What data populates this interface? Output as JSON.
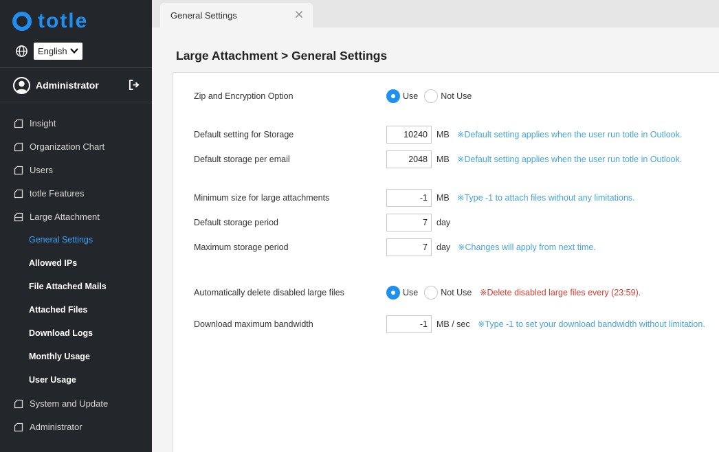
{
  "app": {
    "logo_text": "totle",
    "language": "English",
    "user": "Administrator"
  },
  "nav": {
    "items_top": [
      {
        "label": "Insight"
      },
      {
        "label": "Organization Chart"
      },
      {
        "label": "Users"
      },
      {
        "label": "totle Features"
      },
      {
        "label": "Large Attachment"
      }
    ],
    "sub_items": [
      {
        "label": "General Settings"
      },
      {
        "label": "Allowed IPs"
      },
      {
        "label": "File Attached Mails"
      },
      {
        "label": "Attached Files"
      },
      {
        "label": "Download Logs"
      },
      {
        "label": "Monthly Usage"
      },
      {
        "label": "User Usage"
      }
    ],
    "items_bottom": [
      {
        "label": "System and Update"
      },
      {
        "label": "Administrator"
      }
    ]
  },
  "tab": {
    "label": "General Settings"
  },
  "page": {
    "title": "Large Attachment > General Settings"
  },
  "settings": {
    "zip": {
      "label": "Zip and Encryption Option",
      "use": "Use",
      "not_use": "Not Use"
    },
    "storage": {
      "label": "Default setting for Storage",
      "value": "10240",
      "unit": "MB",
      "note": "※Default setting applies when the user run totle in Outlook."
    },
    "per_email": {
      "label": "Default storage per email",
      "value": "2048",
      "unit": "MB",
      "note": "※Default setting applies when the user run totle in Outlook."
    },
    "min_size": {
      "label": "Minimum size for large attachments",
      "value": "-1",
      "unit": "MB",
      "note": "※Type -1 to attach files without any limitations."
    },
    "period": {
      "label": "Default storage period",
      "value": "7",
      "unit": "day"
    },
    "max_period": {
      "label": "Maximum storage period",
      "value": "7",
      "unit": "day",
      "note": "※Changes will apply from next time."
    },
    "auto_delete": {
      "label": "Automatically delete disabled large files",
      "use": "Use",
      "not_use": "Not Use",
      "note": "※Delete disabled large files every (23:59)."
    },
    "bandwidth": {
      "label": "Download maximum bandwidth",
      "value": "-1",
      "unit": "MB / sec",
      "note": "※Type -1 to set your download bandwidth without limitation."
    }
  }
}
